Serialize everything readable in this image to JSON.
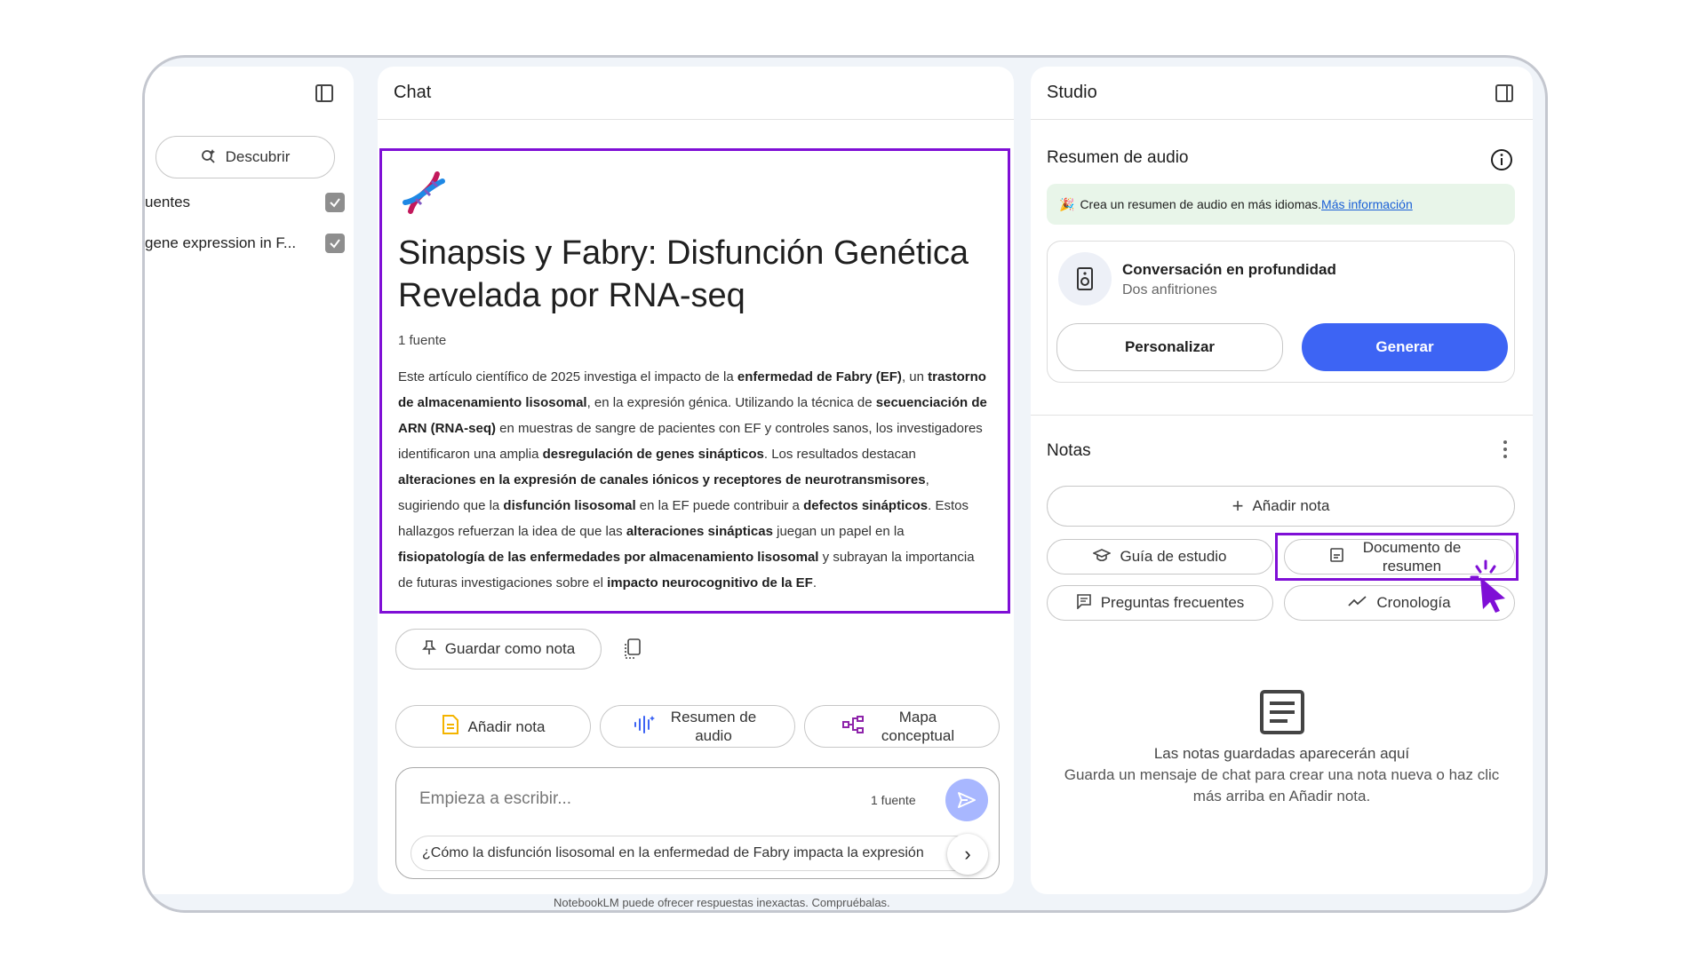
{
  "left_panel": {
    "discover_label": "Descubrir",
    "sources": [
      {
        "label": "uentes",
        "checked": true
      },
      {
        "label": "gene expression in F...",
        "checked": true
      }
    ]
  },
  "chat": {
    "header": "Chat",
    "title": "Sinapsis y Fabry: Disfunción Genética Revelada por RNA-seq",
    "source_count": "1 fuente",
    "summary_parts": [
      {
        "text": "Este artículo científico de 2025 investiga el impacto de la ",
        "bold": false
      },
      {
        "text": "enfermedad de Fabry (EF)",
        "bold": true
      },
      {
        "text": ", un ",
        "bold": false
      },
      {
        "text": "trastorno de almacenamiento lisosomal",
        "bold": true
      },
      {
        "text": ", en la expresión génica. Utilizando la técnica de ",
        "bold": false
      },
      {
        "text": "secuenciación de ARN (RNA-seq)",
        "bold": true
      },
      {
        "text": " en muestras de sangre de pacientes con EF y controles sanos, los investigadores identificaron una amplia ",
        "bold": false
      },
      {
        "text": "desregulación de genes sinápticos",
        "bold": true
      },
      {
        "text": ". Los resultados destacan ",
        "bold": false
      },
      {
        "text": "alteraciones en la expresión de canales iónicos y receptores de neurotransmisores",
        "bold": true
      },
      {
        "text": ", sugiriendo que la ",
        "bold": false
      },
      {
        "text": "disfunción lisosomal",
        "bold": true
      },
      {
        "text": " en la EF puede contribuir a ",
        "bold": false
      },
      {
        "text": "defectos sinápticos",
        "bold": true
      },
      {
        "text": ". Estos hallazgos refuerzan la idea de que las ",
        "bold": false
      },
      {
        "text": "alteraciones sinápticas",
        "bold": true
      },
      {
        "text": " juegan un papel en la ",
        "bold": false
      },
      {
        "text": "fisiopatología de las enfermedades por almacenamiento lisosomal",
        "bold": true
      },
      {
        "text": " y subrayan la importancia de futuras investigaciones sobre el ",
        "bold": false
      },
      {
        "text": "impacto neurocognitivo de la EF",
        "bold": true
      },
      {
        "text": ".",
        "bold": false
      }
    ],
    "save_note": "Guardar como nota",
    "actions": {
      "add_note": "Añadir nota",
      "audio_summary": "Resumen de audio",
      "mind_map": "Mapa conceptual"
    },
    "input_placeholder": "Empieza a escribir...",
    "input_source_count": "1 fuente",
    "suggestion": "¿Cómo la disfunción lisosomal en la enfermedad de Fabry impacta la expresión",
    "footer": "NotebookLM puede ofrecer respuestas inexactas. Compruébalas."
  },
  "studio": {
    "header": "Studio",
    "audio_title": "Resumen de audio",
    "banner_text": "Crea un resumen de audio en más idiomas.",
    "banner_link": "Más información",
    "deep_dive_title": "Conversación en profundidad",
    "deep_dive_sub": "Dos anfitriones",
    "customize": "Personalizar",
    "generate": "Generar",
    "notes_title": "Notas",
    "add_note": "Añadir nota",
    "study_guide": "Guía de estudio",
    "briefing_doc": "Documento de resumen",
    "faq": "Preguntas frecuentes",
    "timeline": "Cronología",
    "empty_title": "Las notas guardadas aparecerán aquí",
    "empty_desc": "Guarda un mensaje de chat para crear una nota nueva o haz clic más arriba en Añadir nota."
  },
  "colors": {
    "highlight": "#7f0fd6",
    "primary_button": "#3d64f4",
    "send_button": "#a8b7ff"
  }
}
